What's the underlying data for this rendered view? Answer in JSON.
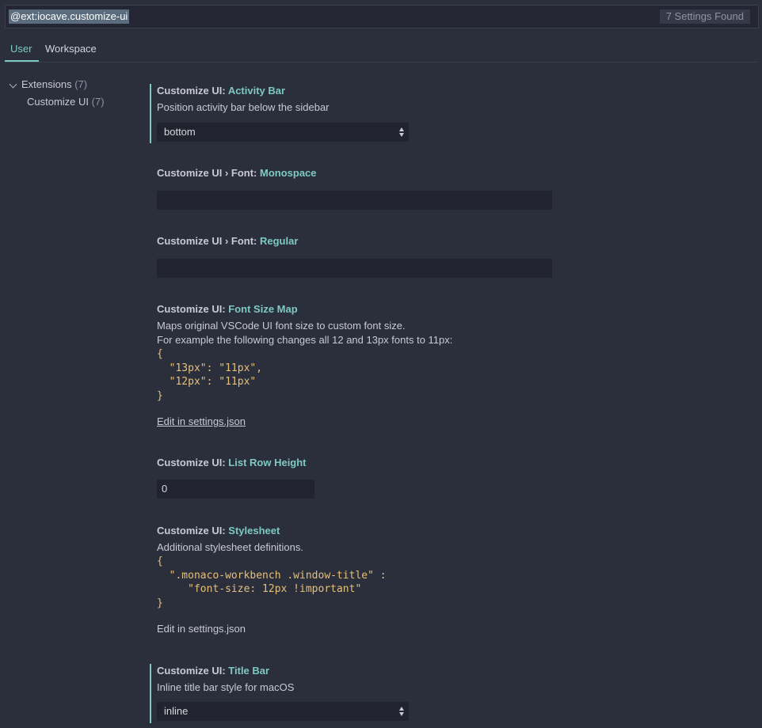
{
  "search": {
    "query": "@ext:iocave.customize-ui",
    "count": "7 Settings Found"
  },
  "tabs": [
    {
      "label": "User"
    },
    {
      "label": "Workspace"
    }
  ],
  "tree": {
    "extensions": {
      "label": "Extensions",
      "count": "(7)"
    },
    "customize_ui": {
      "label": "Customize UI",
      "count": "(7)"
    }
  },
  "settings": {
    "activity_bar": {
      "category": "Customize UI: ",
      "name": "Activity Bar",
      "description": "Position activity bar below the sidebar",
      "value": "bottom"
    },
    "font_mono": {
      "category": "Customize UI › Font: ",
      "name": "Monospace",
      "value": ""
    },
    "font_regular": {
      "category": "Customize UI › Font: ",
      "name": "Regular",
      "value": ""
    },
    "font_size_map": {
      "category": "Customize UI: ",
      "name": "Font Size Map",
      "description_1": "Maps original VSCode UI font size to custom font size.",
      "description_2": "For example the following changes all 12 and 13px fonts to 11px:",
      "code": "{\n  \"13px\": \"11px\",\n  \"12px\": \"11px\"\n}",
      "edit_link": "Edit in settings.json"
    },
    "list_row_height": {
      "category": "Customize UI: ",
      "name": "List Row Height",
      "value": "0"
    },
    "stylesheet": {
      "category": "Customize UI: ",
      "name": "Stylesheet",
      "description": "Additional stylesheet definitions.",
      "code": "{\n  \".monaco-workbench .window-title\" :\n     \"font-size: 12px !important\"\n}",
      "edit_link": "Edit in settings.json"
    },
    "title_bar": {
      "category": "Customize UI: ",
      "name": "Title Bar",
      "description": "Inline title bar style for macOS",
      "value": "inline"
    }
  },
  "colors": {
    "accent": "#7ec9c3",
    "background": "#2b2e3b",
    "code": "#e5c07b"
  }
}
